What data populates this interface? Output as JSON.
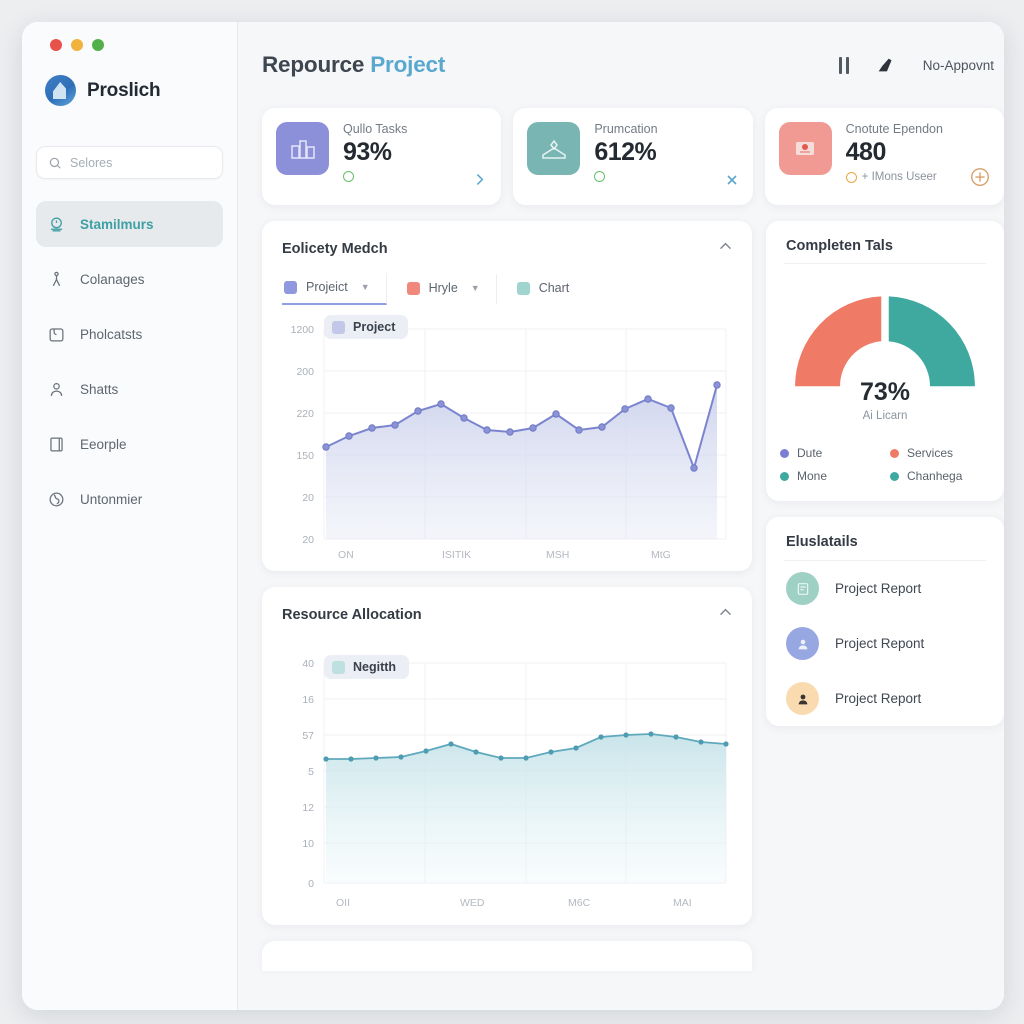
{
  "window": {
    "traffic_lights": [
      "close",
      "minimize",
      "maximize"
    ]
  },
  "brand": {
    "name": "Proslich",
    "logo_icon": "shield-logo-icon"
  },
  "search": {
    "placeholder": "Selores",
    "value": "",
    "icon": "search-icon"
  },
  "sidebar": {
    "items": [
      {
        "label": "Stamilmurs",
        "icon": "dashboard-icon",
        "active": true
      },
      {
        "label": "Colanages",
        "icon": "compass-icon",
        "active": false
      },
      {
        "label": "Pholcatsts",
        "icon": "briefcase-icon",
        "active": false
      },
      {
        "label": "Shatts",
        "icon": "user-icon",
        "active": false
      },
      {
        "label": "Eeorple",
        "icon": "document-icon",
        "active": false
      },
      {
        "label": "Untonmier",
        "icon": "globe-icon",
        "active": false
      }
    ]
  },
  "header": {
    "title_primary": "Repource",
    "title_accent": "Project",
    "pause_icon": "pause-icon",
    "edit_icon": "pen-icon",
    "user_label": "No-Appovnt"
  },
  "stats": [
    {
      "label": "Qullo Tasks",
      "value": "93%",
      "sub": "",
      "icon": "building-icon",
      "icon_bg": "#8b90d8",
      "action_icon": "chevron-right-icon",
      "status_color": "#67c06a"
    },
    {
      "label": "Prumcation",
      "value": "612%",
      "sub": "",
      "icon": "inbox-icon",
      "icon_bg": "#79b6b3",
      "action_icon": "close-icon",
      "status_color": "#67c06a"
    },
    {
      "label": "Cnotute Ependon",
      "value": "480",
      "sub": "+ IMons  Useer",
      "icon": "image-icon",
      "icon_bg": "#f09a93",
      "action_icon": "add-circle-icon",
      "status_color": "#e9a741"
    }
  ],
  "panels": {
    "activity": {
      "title": "Eolicety Medch",
      "collapse_icon": "chevron-up-icon",
      "legend": [
        {
          "label": "Projeict",
          "color": "#9099dd",
          "has_caret": true,
          "selected": true
        },
        {
          "label": "Hryle",
          "color": "#f0887c",
          "has_caret": true,
          "selected": false
        },
        {
          "label": "Chart",
          "color": "#9fd4cf",
          "has_caret": false,
          "selected": false
        }
      ],
      "badge": {
        "label": "Project",
        "color": "#c3c8e8"
      }
    },
    "resource": {
      "title": "Resource Allocation",
      "collapse_icon": "chevron-up-icon",
      "badge": {
        "label": "Negitth",
        "color": "#bfe0e0"
      }
    },
    "gauge": {
      "title": "Completen Tals",
      "value": "73%",
      "caption": "Ai Licarn",
      "legend": [
        {
          "label": "Dute",
          "color": "#7b7fd4"
        },
        {
          "label": "Services",
          "color": "#ef7b66"
        },
        {
          "label": "Mone",
          "color": "#3fa9a0"
        },
        {
          "label": "Chanhega",
          "color": "#3fa9a0"
        }
      ]
    },
    "details": {
      "title": "Eluslatails",
      "rows": [
        {
          "label": "Project Report",
          "avatar_color": "#9ed0c3",
          "icon": "file-avatar-icon"
        },
        {
          "label": "Project Repont",
          "avatar_color": "#97a7e2",
          "icon": "person-avatar-icon"
        },
        {
          "label": "Project Report",
          "avatar_color": "#fadbb0",
          "icon": "person-avatar-icon"
        }
      ]
    }
  },
  "chart_data": [
    {
      "type": "area",
      "title": "Eolicety Medch",
      "series_name": "Projeict",
      "color": "#7b85cf",
      "fill": "#c9cfea",
      "xlabel": "",
      "ylabel": "",
      "ytick_labels": [
        "1200",
        "200",
        "220",
        "150",
        "20",
        "20"
      ],
      "xtick_labels": [
        "ON",
        "ISITIK",
        "MSH",
        "MtG"
      ],
      "ylim": [
        0,
        1200
      ],
      "grid": true,
      "legend_position": "top-left",
      "x": [
        1,
        2,
        3,
        4,
        5,
        6,
        7,
        8,
        9,
        10,
        11,
        12,
        13,
        14,
        15,
        16,
        17,
        18
      ],
      "values": [
        505,
        560,
        600,
        615,
        680,
        710,
        650,
        595,
        585,
        600,
        665,
        590,
        605,
        690,
        740,
        695,
        455,
        790
      ]
    },
    {
      "type": "area",
      "title": "Resource Allocation",
      "series_name": "Negitth",
      "color": "#5fa9bd",
      "fill": "#cfe8ec",
      "xlabel": "",
      "ylabel": "",
      "ytick_labels": [
        "40",
        "16",
        "57",
        "5",
        "12",
        "10",
        "0"
      ],
      "xtick_labels": [
        "OII",
        "WED",
        "M6C",
        "MAI"
      ],
      "ylim": [
        0,
        40
      ],
      "grid": true,
      "legend_position": "top-left",
      "x": [
        1,
        2,
        3,
        4,
        5,
        6,
        7,
        8,
        9,
        10,
        11,
        12,
        13,
        14,
        15,
        16,
        17
      ],
      "values": [
        22.0,
        22.0,
        22.1,
        22.4,
        23.6,
        25.2,
        23.4,
        22.2,
        22.1,
        23.2,
        24.0,
        26.6,
        27.2,
        27.4,
        26.6,
        25.6,
        25.4
      ]
    },
    {
      "type": "pie",
      "title": "Completen Tals",
      "center_label": "73%",
      "labels": [
        "Services",
        "Mone"
      ],
      "values": [
        50,
        50
      ],
      "colors": [
        "#ef7b66",
        "#3fa9a0"
      ]
    }
  ]
}
